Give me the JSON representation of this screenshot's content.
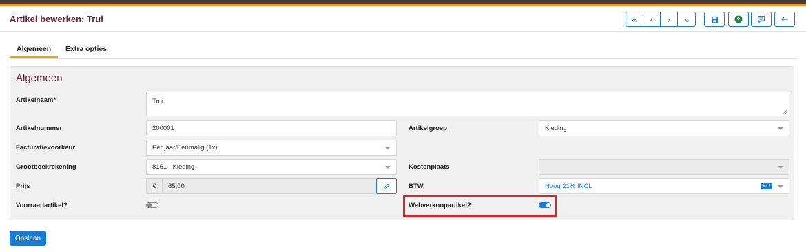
{
  "header": {
    "title": "Artikel bewerken: Trui",
    "nav": [
      "«",
      "‹",
      "›",
      "»"
    ]
  },
  "tabs": [
    {
      "label": "Algemeen",
      "active": true
    },
    {
      "label": "Extra opties",
      "active": false
    }
  ],
  "panel": {
    "title": "Algemeen",
    "fields": {
      "artikelnaam": {
        "label": "Artikelnaam*",
        "value": "Trui"
      },
      "artikelnummer": {
        "label": "Artikelnummer",
        "value": "200001"
      },
      "artikelgroep": {
        "label": "Artikelgroep",
        "value": "Kleding"
      },
      "facturatievoorkeur": {
        "label": "Facturatievoorkeur",
        "value": "Per jaar/Eenmalig (1x)"
      },
      "grootboekrekening": {
        "label": "Grootboekrekening",
        "value": "8151 - Kleding"
      },
      "kostenplaats": {
        "label": "Kostenplaats",
        "value": ""
      },
      "prijs": {
        "label": "Prijs",
        "currency": "€",
        "value": "65,00"
      },
      "btw": {
        "label": "BTW",
        "value": "Hoog 21% INCL",
        "badge": "incl"
      },
      "voorraadartikel": {
        "label": "Voorraadartikel?",
        "checked": false
      },
      "webverkoopartikel": {
        "label": "Webverkoopartikel?",
        "checked": true
      }
    }
  },
  "footer": {
    "save_label": "Opslaan"
  },
  "colors": {
    "accent": "#1a7bd4",
    "brand": "#6b1f3a",
    "tab_underline": "#e8a020",
    "highlight": "#d6262e"
  }
}
